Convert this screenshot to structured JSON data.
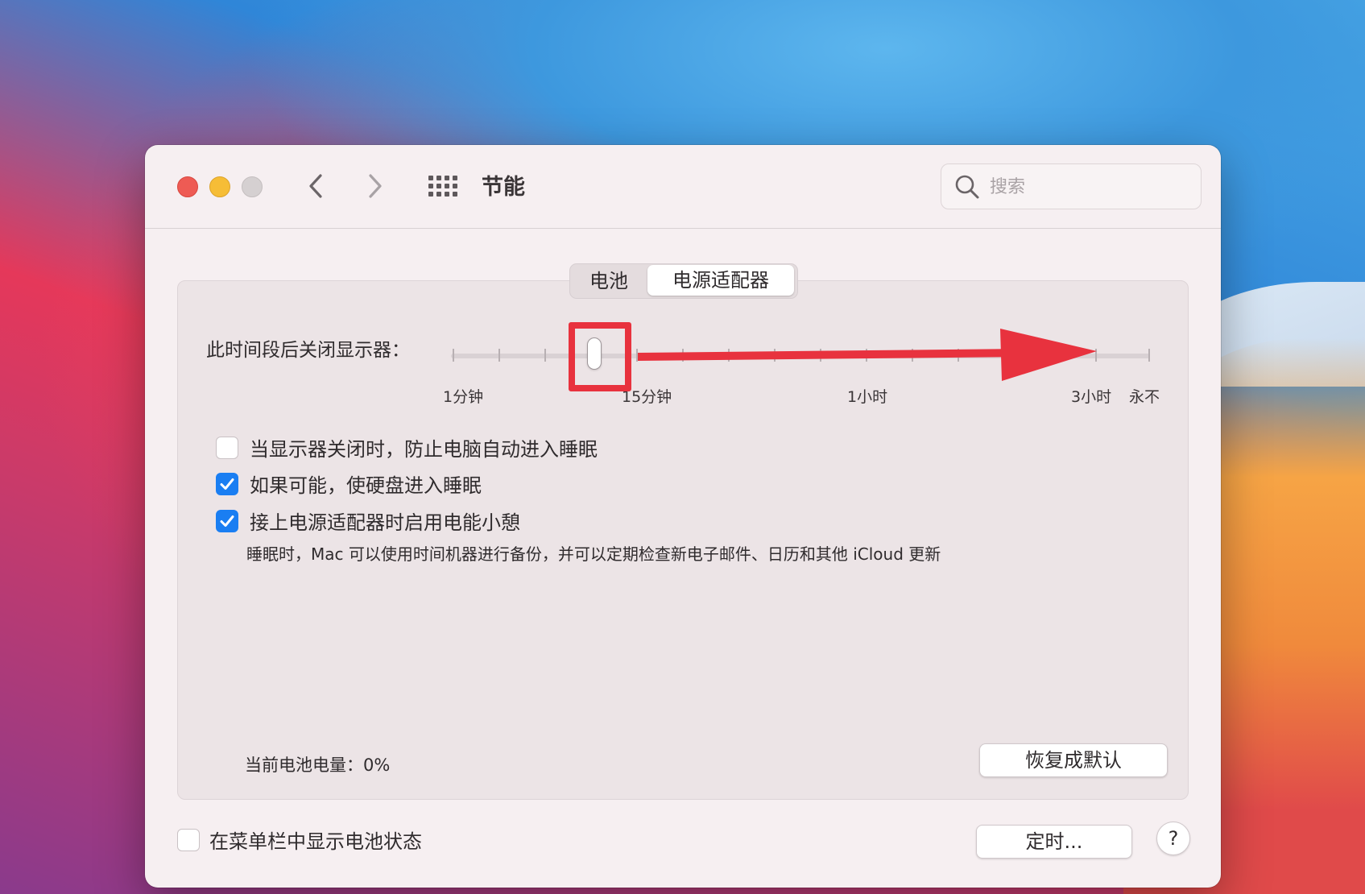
{
  "window": {
    "title": "节能"
  },
  "toolbar": {
    "back_icon": "chevron-left-icon",
    "forward_icon": "chevron-right-icon",
    "grid_icon": "grid-icon"
  },
  "search": {
    "placeholder": "搜索",
    "value": ""
  },
  "tabs": [
    {
      "label": "电池",
      "selected": false
    },
    {
      "label": "电源适配器",
      "selected": true
    }
  ],
  "display_sleep": {
    "label": "此时间段后关闭显示器：",
    "value": "10分钟",
    "tick_labels": [
      "1分钟",
      "15分钟",
      "1小时",
      "3小时",
      "永不"
    ]
  },
  "options": [
    {
      "label": "当显示器关闭时，防止电脑自动进入睡眠",
      "checked": false
    },
    {
      "label": "如果可能，使硬盘进入睡眠",
      "checked": true
    },
    {
      "label": "接上电源适配器时启用电能小憩",
      "checked": true
    }
  ],
  "power_nap_note": "睡眠时，Mac 可以使用时间机器进行备份，并可以定期检查新电子邮件、日历和其他 iCloud 更新",
  "battery_level": "当前电池电量：0%",
  "buttons": {
    "restore_defaults": "恢复成默认",
    "schedule": "定时...",
    "help": "?"
  },
  "menu_bar_battery": {
    "label": "在菜单栏中显示电池状态",
    "checked": false
  },
  "colors": {
    "accent": "#1a7ef2",
    "annotation": "#e8323e",
    "close": "#ee5b54",
    "minimize": "#f6bd36"
  }
}
